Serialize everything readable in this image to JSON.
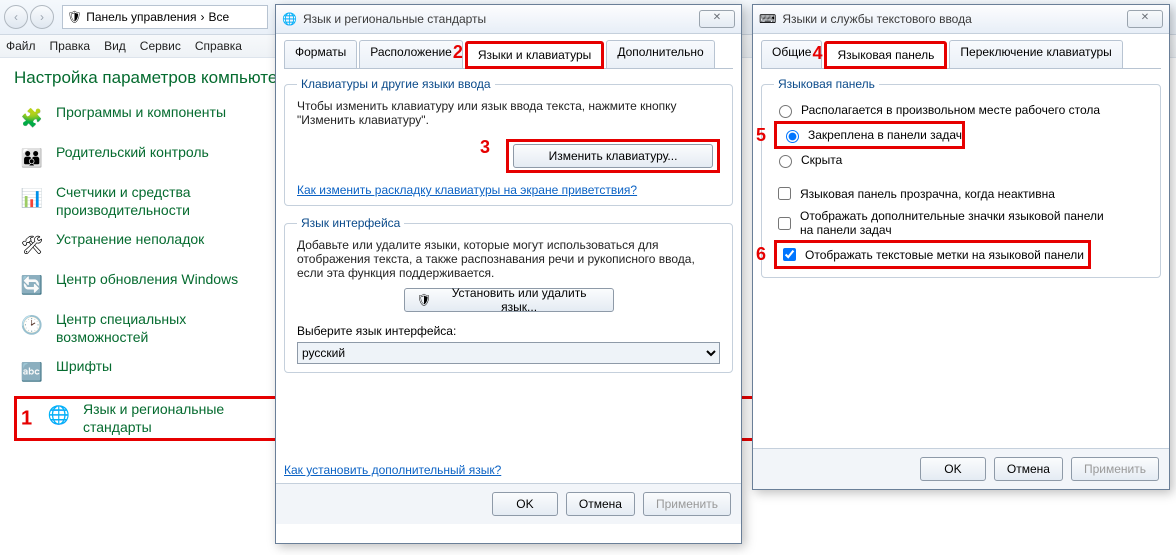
{
  "control_panel": {
    "nav_back": "‹",
    "nav_fwd": "›",
    "address_icon": "🛡",
    "address_text": "Панель управления",
    "address_sep": "›",
    "address_text2": "Все",
    "menu": [
      "Файл",
      "Правка",
      "Вид",
      "Сервис",
      "Справка"
    ],
    "heading": "Настройка параметров компьютера",
    "items": [
      {
        "icon": "🧩",
        "label": "Программы и компоненты"
      },
      {
        "icon": "👪",
        "label": "Родительский контроль"
      },
      {
        "icon": "📊",
        "label": "Счетчики и средства производительности"
      },
      {
        "icon": "🛠",
        "label": "Устранение неполадок"
      },
      {
        "icon": "🔄",
        "label": "Центр обновления Windows"
      },
      {
        "icon": "🕑",
        "label": "Центр специальных возможностей"
      },
      {
        "icon": "🔤",
        "label": "Шрифты"
      },
      {
        "icon": "🌐",
        "label": "Язык и региональные стандарты"
      }
    ],
    "sel1_num": "1"
  },
  "dlg1": {
    "title": "Язык и региональные стандарты",
    "close": "✕",
    "tabs": [
      "Форматы",
      "Расположение",
      "Языки и клавиатуры",
      "Дополнительно"
    ],
    "sel2_num": "2",
    "group1_title": "Клавиатуры и другие языки ввода",
    "group1_desc": "Чтобы изменить клавиатуру или язык ввода текста, нажмите кнопку \"Изменить клавиатуру\".",
    "sel3_num": "3",
    "btn_change_kb": "Изменить клавиатуру...",
    "link1": "Как изменить раскладку клавиатуры на экране приветствия?",
    "group2_title": "Язык интерфейса",
    "group2_desc": "Добавьте или удалите языки, которые могут использоваться для отображения текста, а также распознавания речи и рукописного ввода, если эта функция поддерживается.",
    "btn_install": "Установить или удалить язык...",
    "shield": "🛡",
    "select_label": "Выберите язык интерфейса:",
    "select_value": "русский",
    "link2": "Как установить дополнительный язык?",
    "btn_ok": "OK",
    "btn_cancel": "Отмена",
    "btn_apply": "Применить"
  },
  "dlg2": {
    "title": "Языки и службы текстового ввода",
    "close": "✕",
    "tabs": [
      "Общие",
      "Языковая панель",
      "Переключение клавиатуры"
    ],
    "sel4_num": "4",
    "group_title": "Языковая панель",
    "radio1": "Располагается в произвольном месте рабочего стола",
    "radio2": "Закреплена в панели задач",
    "radio3": "Скрыта",
    "sel5_num": "5",
    "check1": "Языковая панель прозрачна, когда неактивна",
    "check2": "Отображать дополнительные значки языковой панели на панели задач",
    "check3": "Отображать текстовые метки на языковой панели",
    "sel6_num": "6",
    "btn_ok": "OK",
    "btn_cancel": "Отмена",
    "btn_apply": "Применить"
  }
}
